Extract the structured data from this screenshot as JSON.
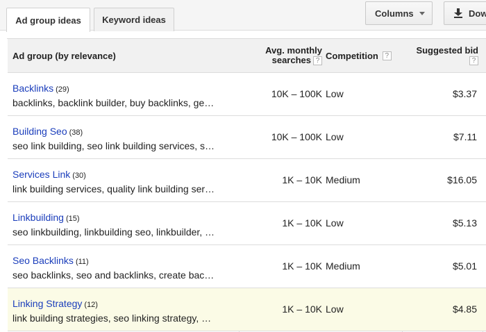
{
  "tabs": [
    {
      "label": "Ad group ideas",
      "active": true
    },
    {
      "label": "Keyword ideas",
      "active": false
    }
  ],
  "toolbar": {
    "columns_label": "Columns",
    "download_label": "Download"
  },
  "table": {
    "headers": {
      "adgroup": "Ad group (by relevance)",
      "searches_line1": "Avg. monthly",
      "searches_line2": "searches",
      "competition": "Competition",
      "bid": "Suggested bid",
      "help": "?"
    },
    "rows": [
      {
        "name": "Backlinks",
        "count": "(29)",
        "keywords": "backlinks, backlink builder, buy backlinks, ge…",
        "searches": "10K – 100K",
        "competition": "Low",
        "bid": "$3.37"
      },
      {
        "name": "Building Seo",
        "count": "(38)",
        "keywords": "seo link building, seo link building services, s…",
        "searches": "10K – 100K",
        "competition": "Low",
        "bid": "$7.11"
      },
      {
        "name": "Services Link",
        "count": "(30)",
        "keywords": "link building services, quality link building ser…",
        "searches": "1K – 10K",
        "competition": "Medium",
        "bid": "$16.05"
      },
      {
        "name": "Linkbuilding",
        "count": "(15)",
        "keywords": "seo linkbuilding, linkbuilding seo, linkbuilder, …",
        "searches": "1K – 10K",
        "competition": "Low",
        "bid": "$5.13"
      },
      {
        "name": "Seo Backlinks",
        "count": "(11)",
        "keywords": "seo backlinks, seo and backlinks, create bac…",
        "searches": "1K – 10K",
        "competition": "Medium",
        "bid": "$5.01"
      },
      {
        "name": "Linking Strategy",
        "count": "(12)",
        "keywords": "link building strategies, seo linking strategy, …",
        "searches": "1K – 10K",
        "competition": "Low",
        "bid": "$4.85"
      }
    ]
  },
  "colors": {
    "link": "#1a3dbb",
    "highlight_row": "#fbfbe6",
    "header_bg": "#f1f1f1"
  }
}
